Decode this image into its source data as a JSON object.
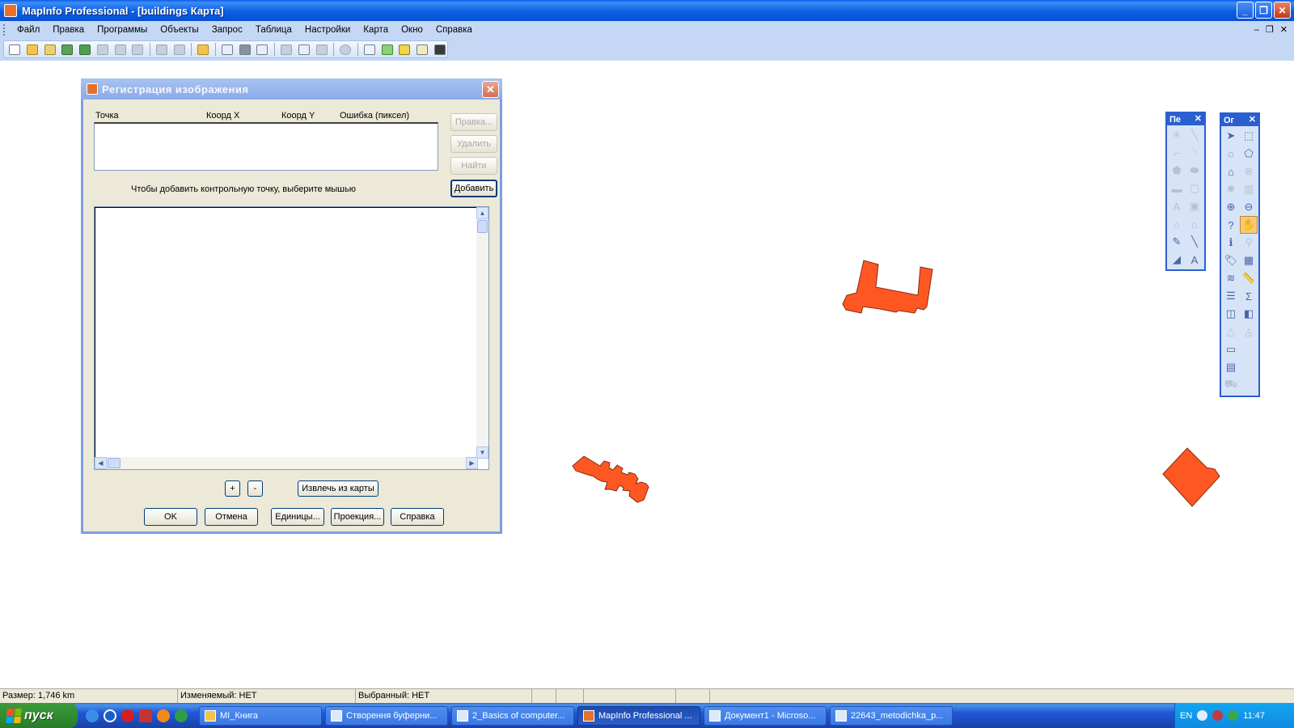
{
  "window": {
    "title": "MapInfo Professional - [buildings Карта]",
    "buttons": {
      "minimize": "_",
      "restore": "❐",
      "close": "✕"
    }
  },
  "menu": {
    "items": [
      "Файл",
      "Правка",
      "Программы",
      "Объекты",
      "Запрос",
      "Таблица",
      "Настройки",
      "Карта",
      "Окно",
      "Справка"
    ],
    "mdi": {
      "minimize": "–",
      "restore": "❐",
      "close": "✕"
    }
  },
  "dialog": {
    "title": "Регистрация изображения",
    "close": "✕",
    "columns": {
      "point": "Точка",
      "x": "Коорд X",
      "y": "Коорд Y",
      "error": "Ошибка (пиксел)"
    },
    "side_buttons": {
      "edit": "Правка...",
      "delete": "Удалить",
      "find": "Найти",
      "add": "Добавить"
    },
    "hint": "Чтобы добавить контрольную точку, выберите мышью",
    "zoom_in": "+",
    "zoom_out": "-",
    "extract": "Извлечь из карты",
    "buttons": {
      "ok": "OK",
      "cancel": "Отмена",
      "units": "Единицы...",
      "projection": "Проекция...",
      "help": "Справка"
    }
  },
  "drawing_toolbar": {
    "title": "Пе",
    "close": "✕"
  },
  "main_toolbar": {
    "title": "Ог",
    "close": "✕"
  },
  "status": {
    "size": "Размер: 1,746 km",
    "editable": "Изменяемый: НЕТ",
    "selected": "Выбранный: НЕТ"
  },
  "taskbar": {
    "start": "пуск",
    "tasks": [
      {
        "label": "MI_Книга",
        "active": false
      },
      {
        "label": "Створення буферни...",
        "active": false
      },
      {
        "label": "2_Basics of computer...",
        "active": false
      },
      {
        "label": "MapInfo Professional ...",
        "active": true
      },
      {
        "label": "Документ1 - Microso...",
        "active": false
      },
      {
        "label": "22643_metodichka_p...",
        "active": false
      }
    ],
    "lang": "EN",
    "clock": "11:47"
  },
  "map": {
    "fill_color": "#ff5722"
  }
}
